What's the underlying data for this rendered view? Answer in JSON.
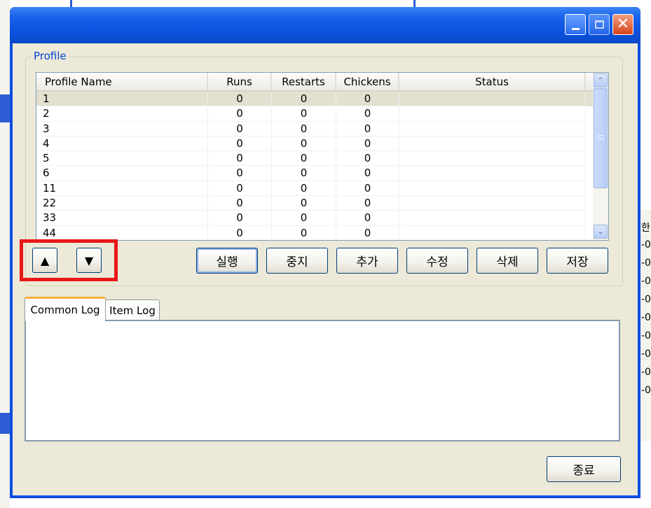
{
  "window": {
    "title": "",
    "controls": {
      "minimize_icon": "minimize-icon",
      "maximize_icon": "maximize-icon",
      "close_icon": "close-icon",
      "close_glyph": "✕"
    }
  },
  "profile_group": {
    "legend": "Profile",
    "columns": [
      "Profile Name",
      "Runs",
      "Restarts",
      "Chickens",
      "Status"
    ],
    "rows": [
      {
        "name": "1",
        "runs": "0",
        "restarts": "0",
        "chickens": "0",
        "status": ""
      },
      {
        "name": "2",
        "runs": "0",
        "restarts": "0",
        "chickens": "0",
        "status": ""
      },
      {
        "name": "3",
        "runs": "0",
        "restarts": "0",
        "chickens": "0",
        "status": ""
      },
      {
        "name": "4",
        "runs": "0",
        "restarts": "0",
        "chickens": "0",
        "status": ""
      },
      {
        "name": "5",
        "runs": "0",
        "restarts": "0",
        "chickens": "0",
        "status": ""
      },
      {
        "name": "6",
        "runs": "0",
        "restarts": "0",
        "chickens": "0",
        "status": ""
      },
      {
        "name": "11",
        "runs": "0",
        "restarts": "0",
        "chickens": "0",
        "status": ""
      },
      {
        "name": "22",
        "runs": "0",
        "restarts": "0",
        "chickens": "0",
        "status": ""
      },
      {
        "name": "33",
        "runs": "0",
        "restarts": "0",
        "chickens": "0",
        "status": ""
      },
      {
        "name": "44",
        "runs": "0",
        "restarts": "0",
        "chickens": "0",
        "status": ""
      }
    ],
    "move_up_glyph": "▲",
    "move_down_glyph": "▼",
    "scroll_up_glyph": "⌃",
    "scroll_down_glyph": "⌄",
    "buttons": {
      "run": "실행",
      "stop": "중지",
      "add": "추가",
      "edit": "수정",
      "delete": "삭제",
      "save": "저장"
    }
  },
  "log_tabs": {
    "tabs": [
      "Common Log",
      "Item Log"
    ],
    "active": "Common Log"
  },
  "footer": {
    "exit_button": "종료"
  },
  "background_right_glyphs": [
    "한",
    "-0",
    "-0",
    "-0",
    "-0",
    "-0",
    "-0",
    "-0",
    "-0",
    "-0"
  ],
  "colors": {
    "titlebar": "#0a52de",
    "client": "#ece9d8",
    "legend_text": "#0046d5",
    "highlight_box": "#e81818",
    "active_tab_accent": "#f6b03b"
  }
}
